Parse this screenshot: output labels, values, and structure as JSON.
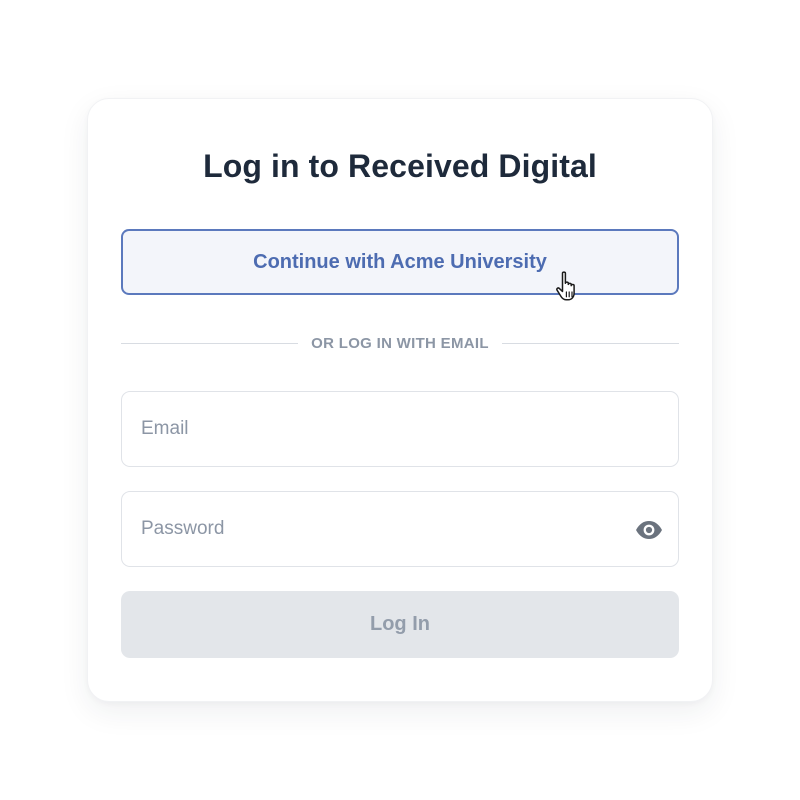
{
  "login": {
    "title": "Log in to Received Digital",
    "sso_button_label": "Continue with Acme University",
    "divider_text": "OR LOG IN WITH EMAIL",
    "email": {
      "value": "",
      "placeholder": "Email"
    },
    "password": {
      "value": "",
      "placeholder": "Password"
    },
    "submit_label": "Log In",
    "submit_state": "disabled"
  },
  "icons": {
    "password_toggle": "eye-icon",
    "pointer": "hand-pointer-cursor-icon"
  },
  "colors": {
    "title": "#1e2a3b",
    "sso_border": "#5b79bd",
    "sso_text": "#4d6cb1",
    "sso_background": "#f3f5fa",
    "muted_text": "#8c96a5",
    "disabled_button": "#e3e6ea",
    "field_border": "#e0e3e8"
  }
}
